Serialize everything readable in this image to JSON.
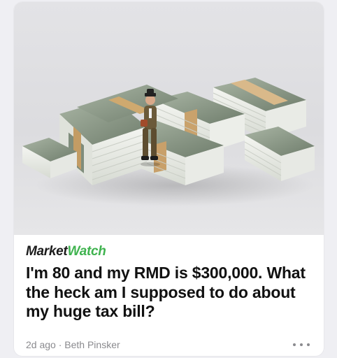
{
  "article": {
    "publisher_part1": "Market",
    "publisher_part2": "Watch",
    "headline": "I'm 80 and my RMD is $300,000. What the heck am I supposed to do about my huge tax bill?",
    "age": "2d ago",
    "separator": "·",
    "author": "Beth Pinsker",
    "more_icon": "more-horizontal-icon",
    "image_icon": "money-stacks-photo"
  },
  "colors": {
    "brand_dark": "#1b1b1b",
    "brand_green": "#3fb34f",
    "meta_gray": "#8a8a8e",
    "background": "#efeff3"
  }
}
